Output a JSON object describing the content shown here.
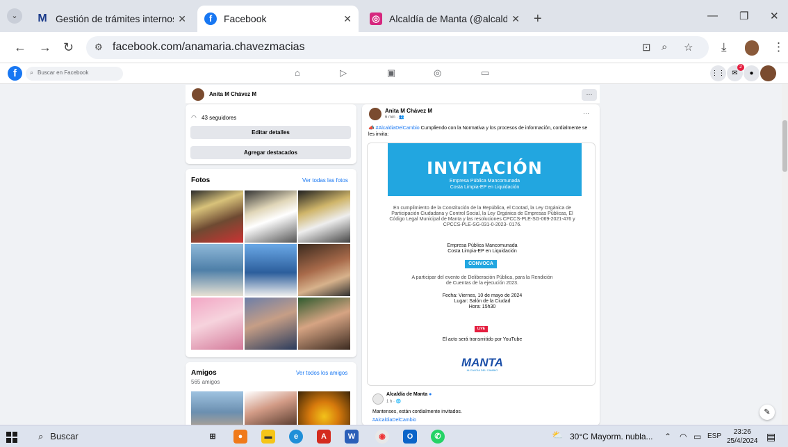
{
  "browser": {
    "tabs": [
      {
        "title": "Gestión de trámites internos",
        "icon": "gmail-icon"
      },
      {
        "title": "Facebook",
        "icon": "facebook-icon"
      },
      {
        "title": "Alcaldía de Manta (@alcaldiade",
        "icon": "instagram-icon"
      }
    ],
    "url": "facebook.com/anamaria.chavezmacias"
  },
  "facebook": {
    "search_placeholder": "Buscar en Facebook",
    "notification_count": "2",
    "profile_name": "Anita M Chávez M"
  },
  "left_column": {
    "followers": "43 seguidores",
    "edit_details": "Editar detalles",
    "add_featured": "Agregar destacados",
    "photos_title": "Fotos",
    "see_all_photos": "Ver todas las fotos",
    "friends_title": "Amigos",
    "friends_count": "565 amigos",
    "see_all_friends": "Ver todos los amigos"
  },
  "post": {
    "author": "Anita M Chávez M",
    "time": "6 min · 👥",
    "hashtag": "#AlcaldiaDelCambio",
    "caption": " Cumpliendo con la Normativa y los procesos de información, cordialmente se les invita:",
    "flyer": {
      "title": "INVITACIÓN",
      "subtitle1": "Empresa Pública Mancomunada",
      "subtitle2": "Costa Limpia-EP en Liquidación",
      "legal": "En cumplimiento de la Constitución de la República, el Cootad, la Ley Orgánica de Participación Ciudadana y Control Social, la Ley Orgánica de Empresas Públicas, El Código Legal Municipal de Manta y las resoluciones CPCCS-PLE-SG-069-2021-476 y CPCCS-PLE-SG-031-0-2023- 0176.",
      "entity1": "Empresa Pública Mancomunada",
      "entity2": "Costa Limpia-EP en Liquidación",
      "convoca": "CONVOCA",
      "purpose": "A participar del evento de Deliberación Pública, para la Rendición de Cuentas de la ejecución 2023.",
      "date": "Fecha: Viernes, 10 de mayo de 2024",
      "place": "Lugar: Salón de la Ciudad",
      "hour": "Hora: 15h30",
      "live": "LIVE",
      "broadcast": "El acto será transmitido por YouTube",
      "logo": "MANTA",
      "logo_sub": "ALCALDÍA DEL CAMBIO"
    },
    "shared": {
      "author": "Alcaldía de Manta",
      "time": "1 h · 🌐",
      "text": "Mantenses, están cordialmente invitados.",
      "hashtag": "#AlcaldiaDelCambio"
    }
  },
  "taskbar": {
    "search": "Buscar",
    "weather": "30°C  Mayorm. nubla...",
    "lang": "ESP",
    "time": "23:26",
    "date": "25/4/2024"
  }
}
